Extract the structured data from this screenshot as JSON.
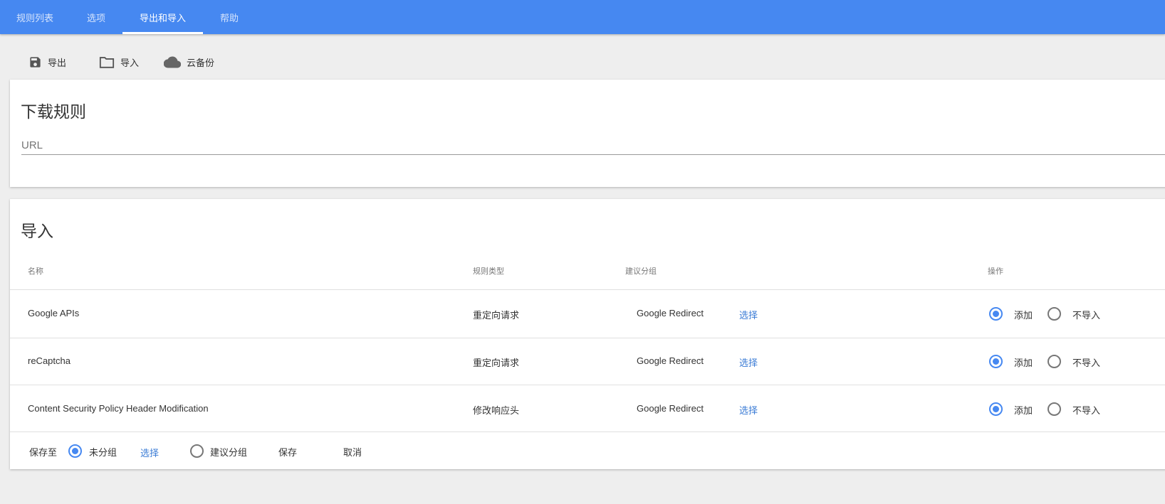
{
  "tabs": [
    {
      "label": "规则列表"
    },
    {
      "label": "选项"
    },
    {
      "label": "导出和导入"
    },
    {
      "label": "帮助"
    }
  ],
  "toolbar": {
    "export": "导出",
    "import": "导入",
    "cloud": "云备份"
  },
  "download": {
    "title": "下载规则",
    "url_placeholder": "URL"
  },
  "import": {
    "title": "导入",
    "headers": {
      "name": "名称",
      "type": "规则类型",
      "group": "建议分组",
      "action": "操作"
    },
    "rows": [
      {
        "name": "Google APIs",
        "type": "重定向请求",
        "group": "Google Redirect",
        "select": "选择",
        "add": "添加",
        "skip": "不导入"
      },
      {
        "name": "reCaptcha",
        "type": "重定向请求",
        "group": "Google Redirect",
        "select": "选择",
        "add": "添加",
        "skip": "不导入"
      },
      {
        "name": "Content Security Policy Header Modification",
        "type": "修改响应头",
        "group": "Google Redirect",
        "select": "选择",
        "add": "添加",
        "skip": "不导入"
      }
    ],
    "footer": {
      "save_to": "保存至",
      "ungrouped": "未分组",
      "select": "选择",
      "suggested": "建议分组",
      "save": "保存",
      "cancel": "取消"
    }
  },
  "colors": {
    "primary": "#4688f1",
    "link": "#3a7bd5"
  }
}
